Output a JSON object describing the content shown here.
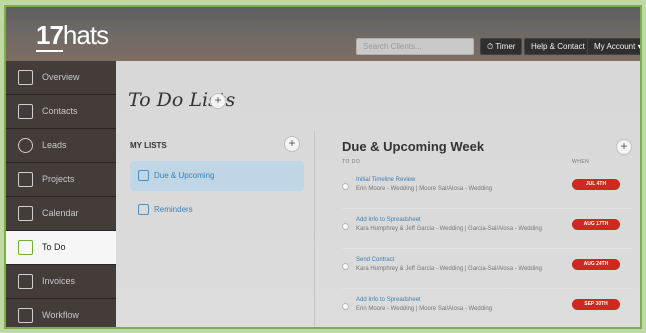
{
  "header": {
    "logo_number": "17",
    "logo_text": "hats",
    "search_placeholder": "Search Clients...",
    "timer_label": "⏱ Timer",
    "help_label": "Help & Contact",
    "account_label": "My Account ▾"
  },
  "sidebar": {
    "items": [
      {
        "label": "Overview",
        "icon": "chart-icon"
      },
      {
        "label": "Contacts",
        "icon": "contacts-icon"
      },
      {
        "label": "Leads",
        "icon": "leads-icon"
      },
      {
        "label": "Projects",
        "icon": "projects-icon"
      },
      {
        "label": "Calendar",
        "icon": "calendar-icon"
      },
      {
        "label": "To Do",
        "icon": "todo-icon"
      },
      {
        "label": "Invoices",
        "icon": "invoices-icon"
      },
      {
        "label": "Workflow",
        "icon": "workflow-icon"
      }
    ],
    "active": "To Do"
  },
  "main": {
    "title": "To Do Lists",
    "add_symbol": "+",
    "my_lists": {
      "heading": "MY LISTS",
      "items": [
        "Due & Upcoming",
        "Reminders"
      ]
    },
    "todo": {
      "title": "Due & Upcoming Week",
      "col_todo": "TO DO",
      "col_when": "WHEN",
      "tasks": [
        {
          "title": "Initial Timeline Review",
          "sub": "Erin Moore - Wedding | Moore Sal/Alosa - Wedding",
          "due": "JUL 4TH"
        },
        {
          "title": "Add Info to Spreadsheet",
          "sub": "Kara Humphrey & Jeff Garcia - Wedding | Garcia-Sal/Alosa - Wedding",
          "due": "AUG 17TH"
        },
        {
          "title": "Send Contract",
          "sub": "Kara Humphrey & Jeff Garcia - Wedding | Garcia-Sal/Alosa - Wedding",
          "due": "AUG 24TH"
        },
        {
          "title": "Add Info to Spreadsheet",
          "sub": "Erin Moore - Wedding | Moore Sal/Alosa - Wedding",
          "due": "SEP 30TH"
        }
      ]
    }
  },
  "colors": {
    "accent_green": "#6fae3c",
    "due_red": "#d0281e",
    "link_blue": "#3b7fb4"
  }
}
